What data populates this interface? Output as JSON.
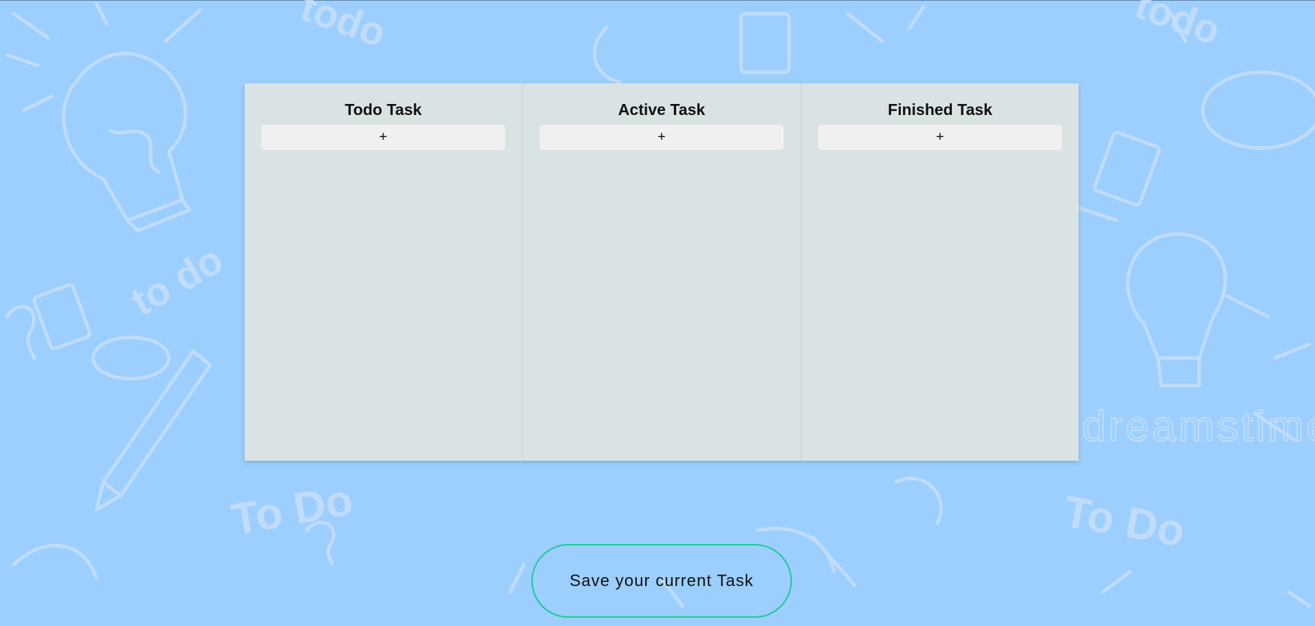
{
  "columns": [
    {
      "title": "Todo Task",
      "add_label": "+"
    },
    {
      "title": "Active Task",
      "add_label": "+"
    },
    {
      "title": "Finished Task",
      "add_label": "+"
    }
  ],
  "save_button": {
    "label": "Save your current Task"
  },
  "colors": {
    "background": "#9ccffd",
    "board": "#dae3e4",
    "add_button": "#f0f0f0",
    "save_border": "#1fc795",
    "doodle": "#c4def9"
  },
  "background_watermark": "dreamstime",
  "background_doodle_texts": [
    "todo",
    "to do"
  ]
}
